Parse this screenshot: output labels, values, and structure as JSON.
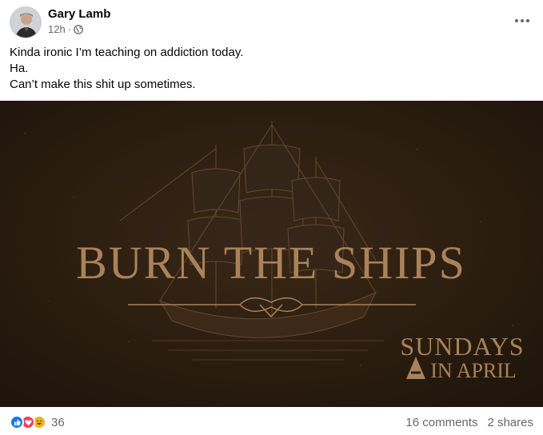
{
  "post": {
    "author": "Gary Lamb",
    "time": "12h",
    "separator": "·",
    "audience_icon": "globe-icon",
    "more_icon": "more-options-icon",
    "text_lines": [
      "Kinda ironic I’m teaching on addiction today.",
      "Ha.",
      "Can’t make this shit up sometimes."
    ],
    "image": {
      "title": "BURN THE SHIPS",
      "subtitle_line1": "SUNDAYS",
      "subtitle_line2": "IN APRIL",
      "logo_letter": "A",
      "background_color": "#2a1d10",
      "accent_color": "#a9825a"
    },
    "footer": {
      "reaction_icons": [
        "like-icon",
        "love-icon",
        "haha-icon"
      ],
      "reaction_count": "36",
      "comments": "16 comments",
      "shares": "2 shares"
    }
  }
}
